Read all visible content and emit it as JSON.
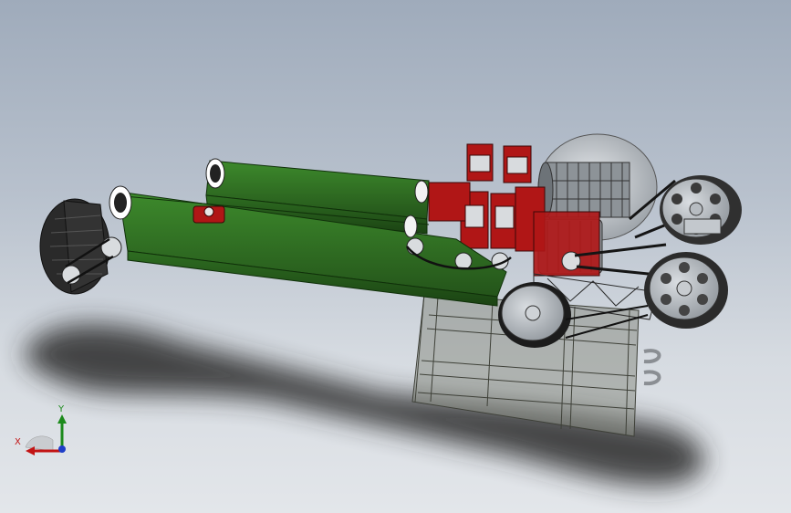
{
  "viewport": {
    "background_top": "#9fabbb",
    "background_bottom": "#e3e6ea"
  },
  "model": {
    "frame_color": "#2f6b22",
    "bearing_color": "#b01616",
    "roller_color": "#2a2a2a",
    "pulley_color": "#9ea4aa",
    "cabinet_color": "#8c8f86"
  },
  "triad": {
    "x_label": "X",
    "y_label": "Y",
    "x_color": "#c21414",
    "y_color": "#1c8a1c",
    "z_color": "#1e3ec8"
  }
}
